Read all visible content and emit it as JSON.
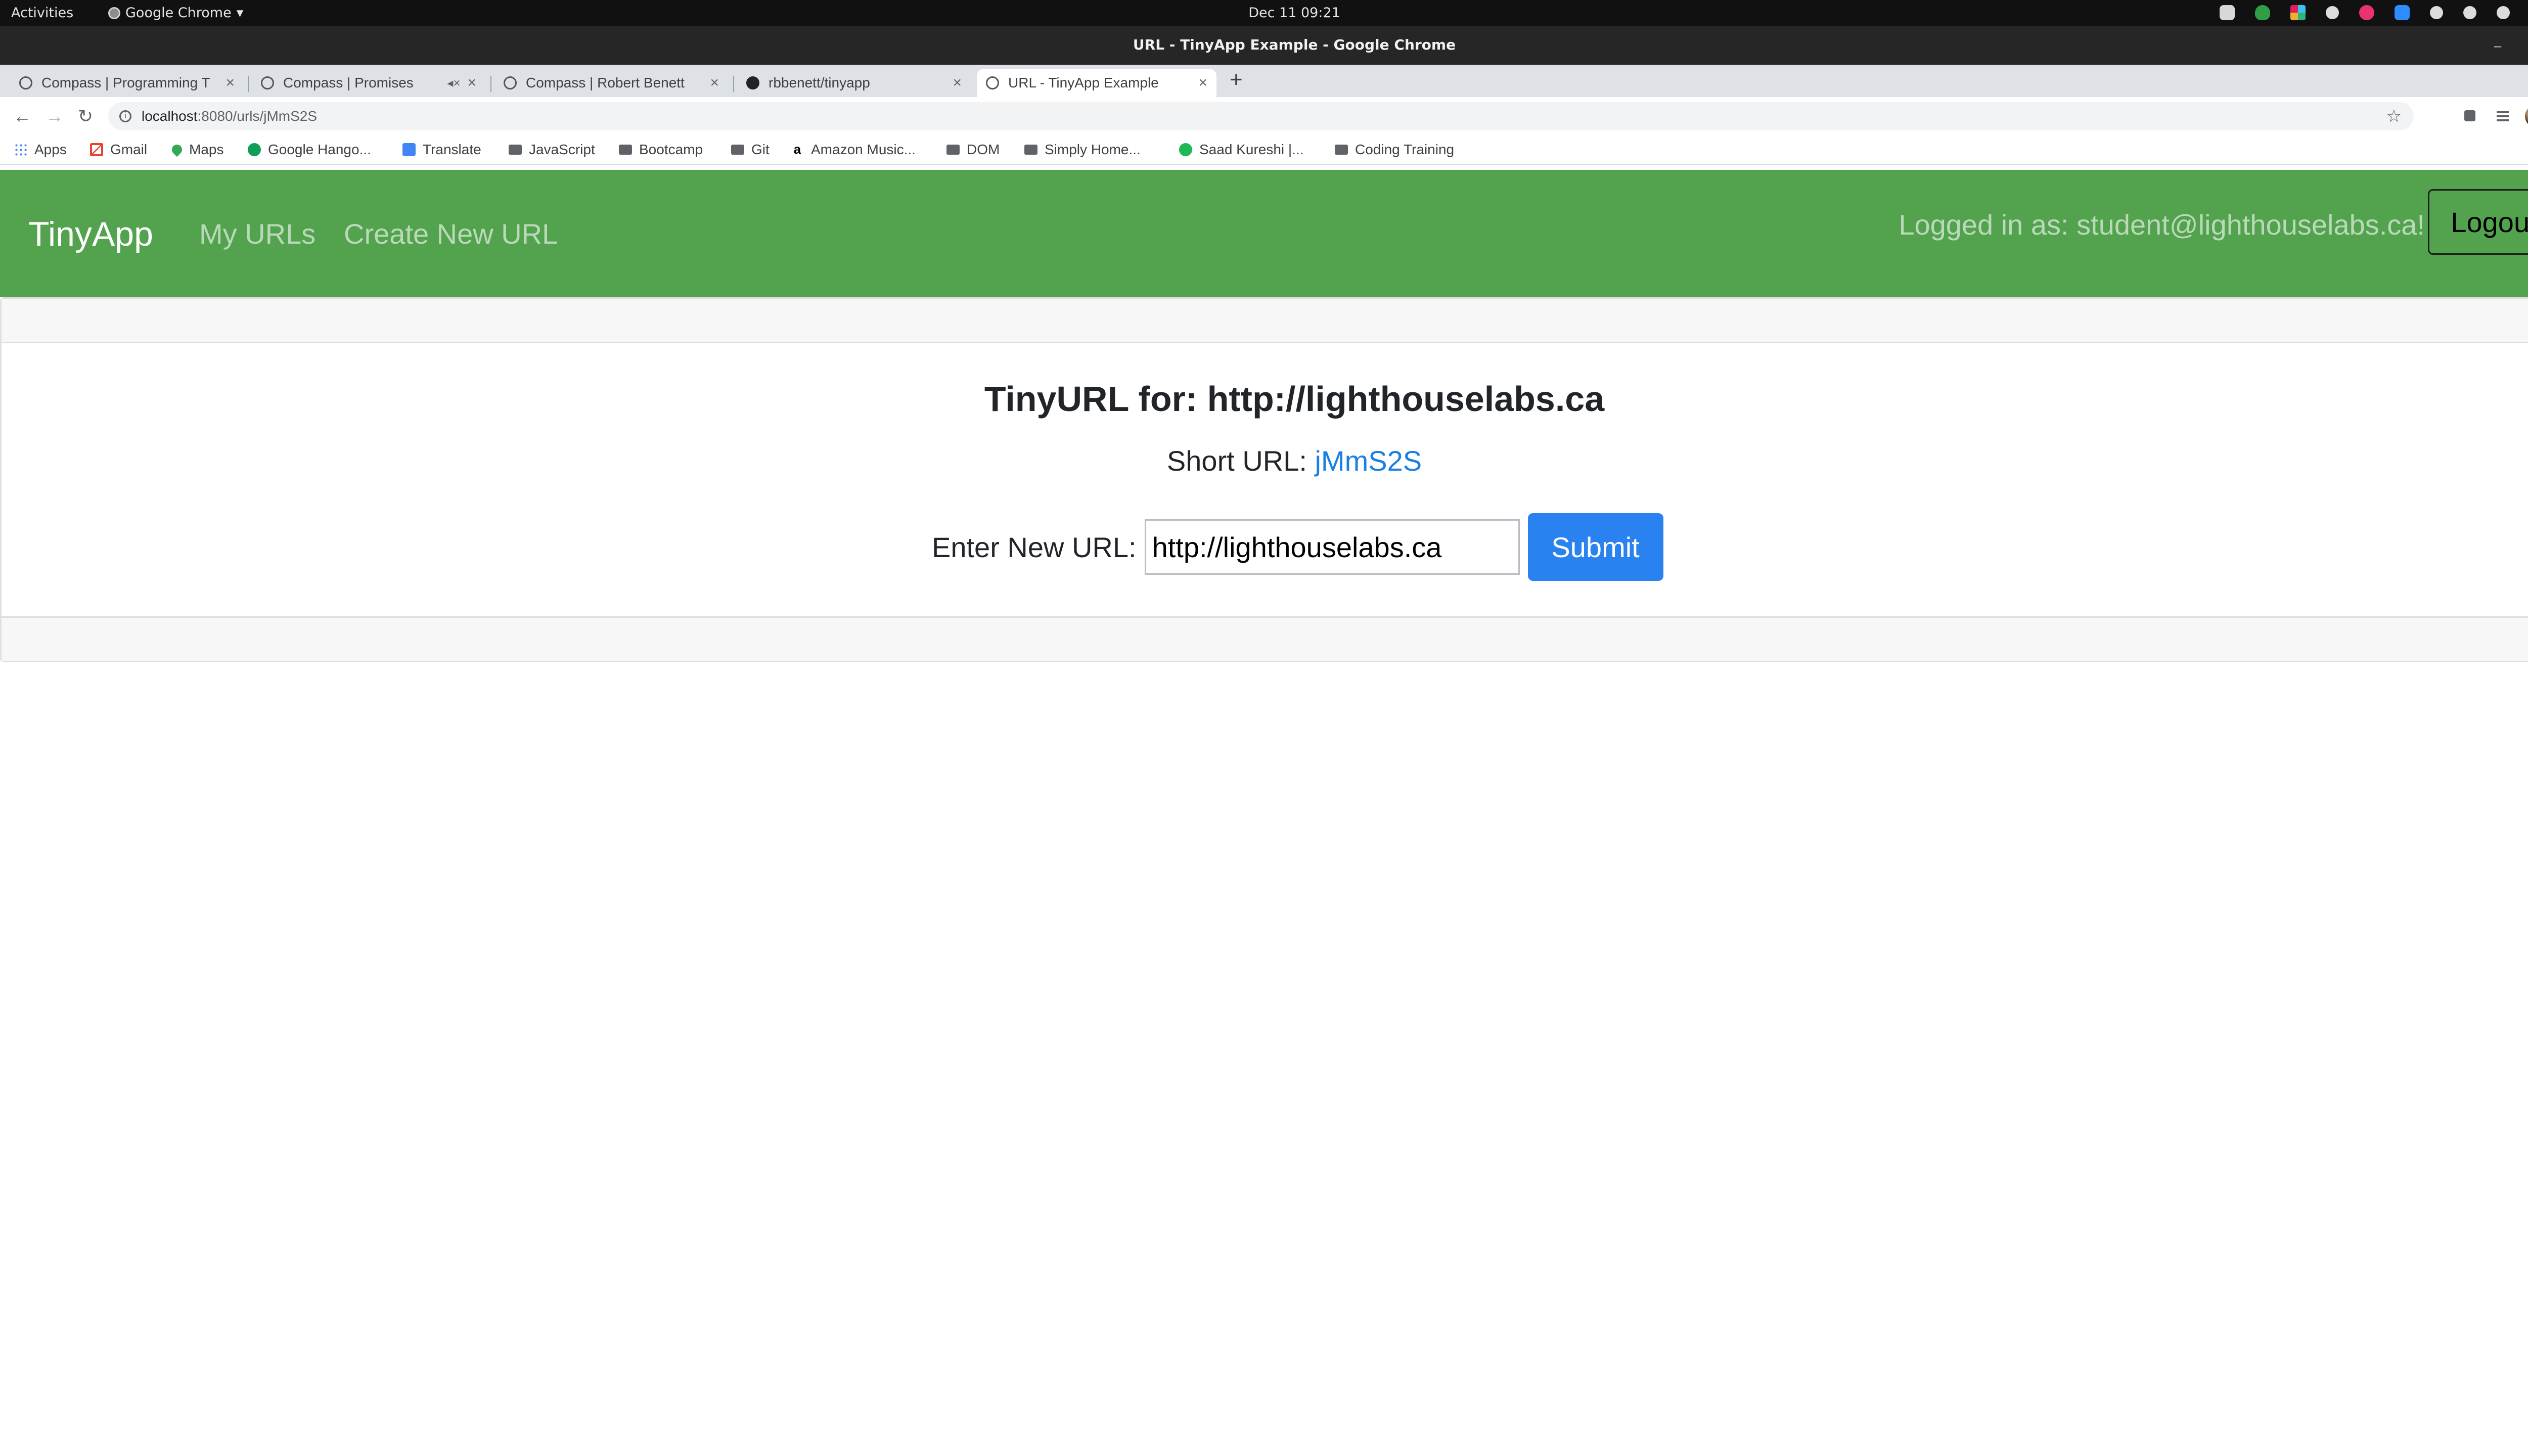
{
  "topbar": {
    "activities": "Activities",
    "app_name": "Google Chrome",
    "clock": "Dec 11  09:21"
  },
  "window": {
    "title": "URL - TinyApp Example - Google Chrome"
  },
  "tabs": [
    {
      "label": "Compass | Programming T",
      "icon": "compass-icon"
    },
    {
      "label": "Compass | Promises",
      "icon": "compass-icon"
    },
    {
      "label": "Compass | Robert Benett",
      "icon": "compass-icon"
    },
    {
      "label": "rbbenett/tinyapp",
      "icon": "github-icon"
    },
    {
      "label": "URL - TinyApp Example",
      "icon": "globe-icon",
      "active": true
    }
  ],
  "address": {
    "host": "localhost",
    "path": ":8080/urls/jMmS2S"
  },
  "bookmarks": [
    {
      "label": "Apps",
      "icon": "apps-grid-icon"
    },
    {
      "label": "Gmail",
      "icon": "gmail-icon"
    },
    {
      "label": "Maps",
      "icon": "maps-icon"
    },
    {
      "label": "Google Hango...",
      "icon": "hangouts-icon"
    },
    {
      "label": "Translate",
      "icon": "translate-icon"
    },
    {
      "label": "JavaScript",
      "icon": "folder-icon"
    },
    {
      "label": "Bootcamp",
      "icon": "folder-icon"
    },
    {
      "label": "Git",
      "icon": "folder-icon"
    },
    {
      "label": "Amazon Music...",
      "icon": "amazon-icon"
    },
    {
      "label": "DOM",
      "icon": "folder-icon"
    },
    {
      "label": "Simply Home...",
      "icon": "folder-icon"
    },
    {
      "label": "Saad Kureshi |...",
      "icon": "spotify-icon"
    },
    {
      "label": "Coding Training",
      "icon": "folder-icon"
    }
  ],
  "navbar": {
    "brand": "TinyApp",
    "my_urls": "My URLs",
    "create_url": "Create New URL",
    "logged_in": "Logged in as: student@lighthouselabs.ca!",
    "logout": "Logout",
    "bg_color": "#52a24e"
  },
  "card": {
    "title": "TinyURL for: http://lighthouselabs.ca",
    "short_label": "Short URL: ",
    "short_link": "jMmS2S",
    "form_label": "Enter New URL:",
    "input_value": "http://lighthouselabs.ca",
    "submit": "Submit",
    "link_color": "#1a7fe0",
    "button_color": "#2a82f0"
  }
}
